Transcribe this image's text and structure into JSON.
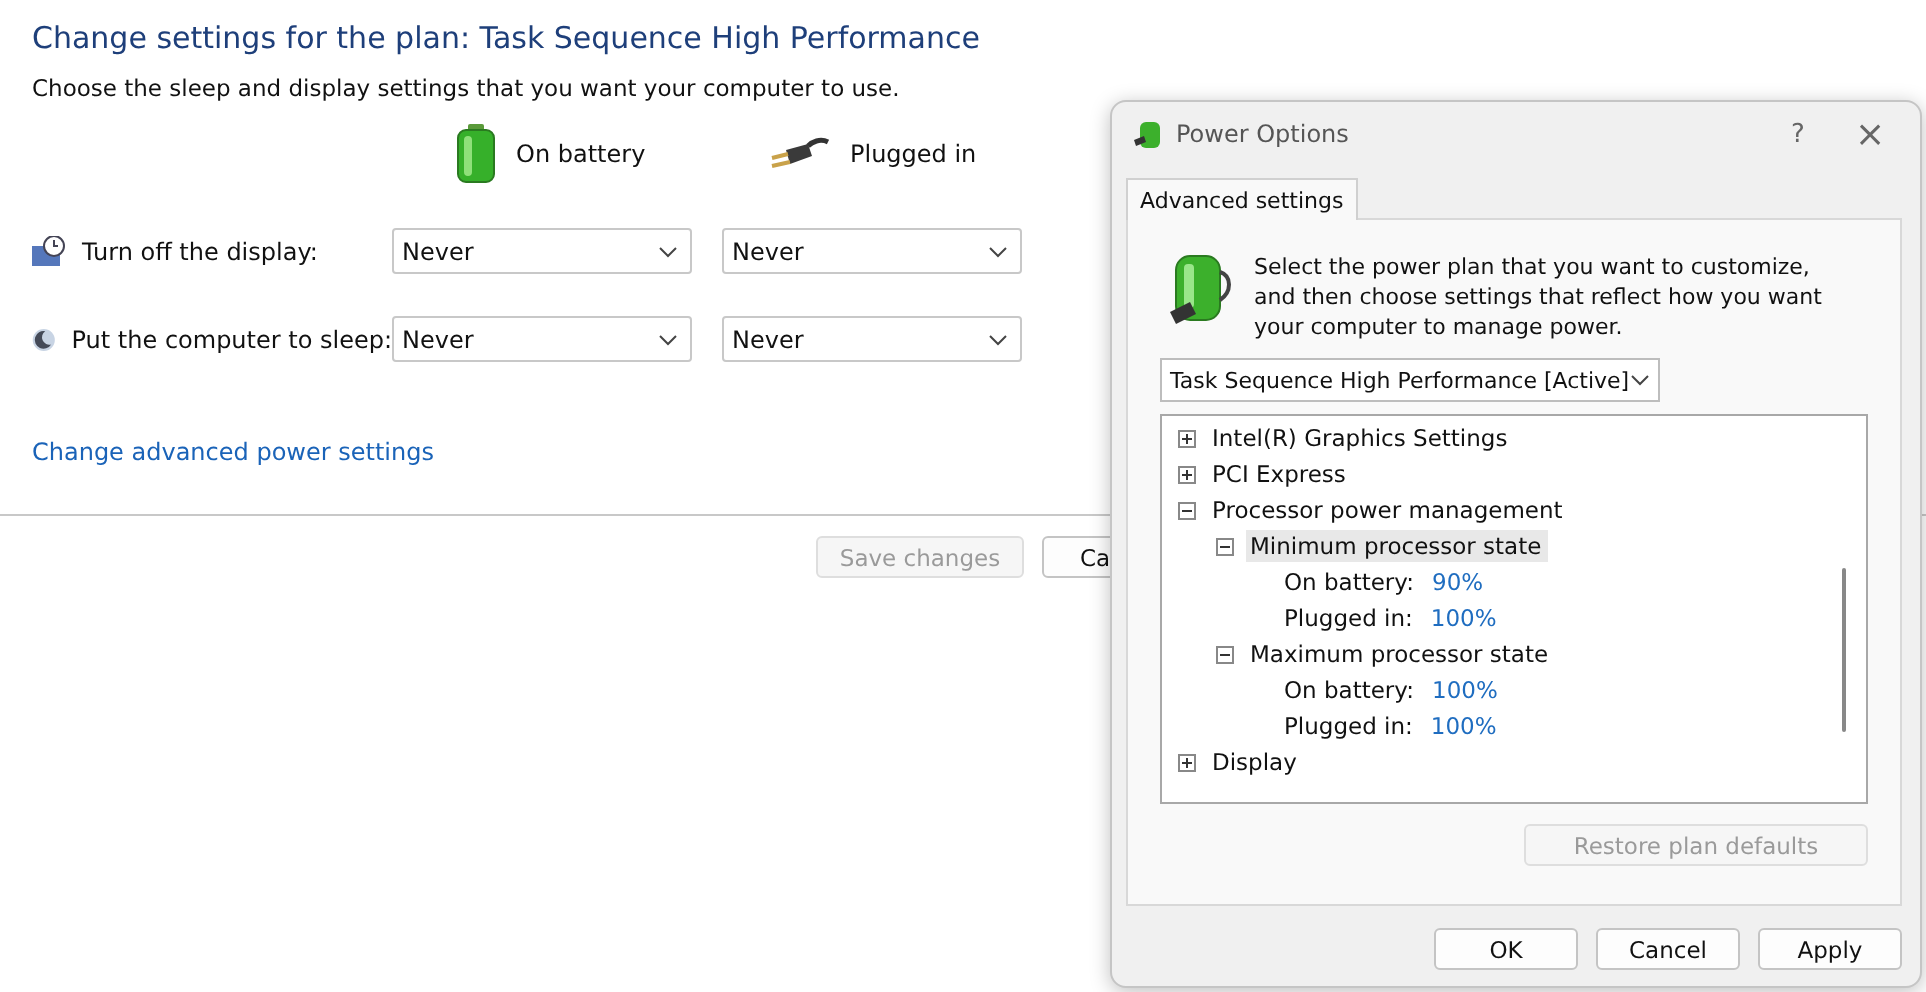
{
  "page": {
    "title": "Change settings for the plan: Task Sequence High Performance",
    "subtitle": "Choose the sleep and display settings that you want your computer to use.",
    "columns": [
      {
        "kind": "battery",
        "label": "On battery"
      },
      {
        "kind": "plug",
        "label": "Plugged in"
      }
    ],
    "settings": [
      {
        "kind": "display",
        "label": "Turn off the display:",
        "values": [
          "Never",
          "Never"
        ]
      },
      {
        "kind": "sleep",
        "label": "Put the computer to sleep:",
        "values": [
          "Never",
          "Never"
        ]
      }
    ],
    "link": "Change advanced power settings",
    "buttons": [
      {
        "label": "Save changes",
        "disabled": true
      },
      {
        "label": "Ca",
        "disabled": false
      }
    ]
  },
  "dialog": {
    "title": "Power Options",
    "help": "?",
    "close": "×",
    "tabs": [
      {
        "label": "Advanced settings",
        "selected": true
      }
    ],
    "intro": "Select the power plan that you want to customize, and then choose settings that reflect how you want your computer to manage power.",
    "plan": "Task Sequence High Performance [Active]",
    "tree": [
      {
        "label": "Intel(R) Graphics Settings",
        "expanded": false,
        "selected": false
      },
      {
        "label": "PCI Express",
        "expanded": false,
        "selected": false
      },
      {
        "label": "Processor power management",
        "expanded": true,
        "selected": false,
        "children": [
          {
            "label": "Minimum processor state",
            "expanded": true,
            "selected": true,
            "children": [
              {
                "label": "On battery:",
                "value": "90%"
              },
              {
                "label": "Plugged in:",
                "value": "100%"
              }
            ]
          },
          {
            "label": "Maximum processor state",
            "expanded": true,
            "selected": false,
            "children": [
              {
                "label": "On battery:",
                "value": "100%"
              },
              {
                "label": "Plugged in:",
                "value": "100%"
              }
            ]
          }
        ]
      },
      {
        "label": "Display",
        "expanded": false,
        "selected": false
      }
    ],
    "restore": {
      "label": "Restore plan defaults",
      "disabled": true
    },
    "buttons": [
      {
        "label": "OK",
        "disabled": false
      },
      {
        "label": "Cancel",
        "disabled": false
      },
      {
        "label": "Apply",
        "disabled": false
      }
    ]
  }
}
